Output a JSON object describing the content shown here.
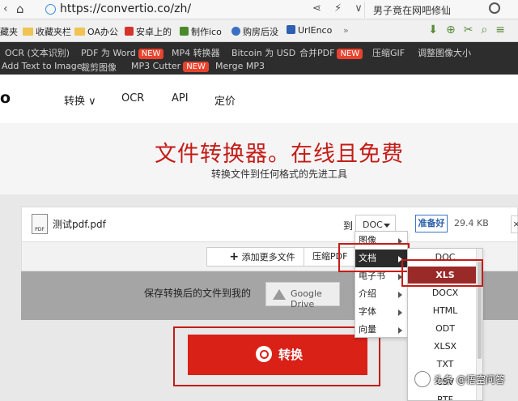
{
  "browser": {
    "url": "https://convertio.co/zh/",
    "search_text": "男子竟在网吧修仙"
  },
  "bookmarks": [
    {
      "label": "藏夹",
      "icon": "folder-icon"
    },
    {
      "label": "收藏夹栏",
      "icon": "folder-icon"
    },
    {
      "label": "OA办公",
      "icon": "folder-icon"
    },
    {
      "label": "安卓上的",
      "icon": "site-icon"
    },
    {
      "label": "制作ico",
      "icon": "site-icon"
    },
    {
      "label": "购房后没",
      "icon": "site-icon"
    },
    {
      "label": "UrlEnco",
      "icon": "site-icon"
    }
  ],
  "tools_row1": [
    {
      "label": "OCR (文本识别)"
    },
    {
      "label": "PDF 为 Word",
      "badge": "NEW"
    },
    {
      "label": "MP4 转换器"
    },
    {
      "label": "Bitcoin 为 USD"
    },
    {
      "label": "合并PDF",
      "badge": "NEW"
    },
    {
      "label": "压缩GIF"
    },
    {
      "label": "调整图像大小"
    }
  ],
  "tools_row2": [
    {
      "label": "Add Text to Image"
    },
    {
      "label": "裁剪图像"
    },
    {
      "label": "MP3 Cutter",
      "badge": "NEW"
    },
    {
      "label": "Merge MP3"
    }
  ],
  "site": {
    "logo_fragment": "o",
    "nav": [
      "转换 ∨",
      "OCR",
      "API",
      "定价"
    ]
  },
  "hero": {
    "title": "文件转换器。在线且免费",
    "subtitle": "转换文件到任何格式的先进工具"
  },
  "file": {
    "icon_label": "PDF",
    "name": "测试pdf.pdf",
    "to_label": "到",
    "format": "DOC",
    "status": "准备好",
    "size": "29.4 KB",
    "remove": "×"
  },
  "actions": {
    "add_more": "添加更多文件",
    "compress": "压缩PDF"
  },
  "save": {
    "label": "保存转换后的文件到我的",
    "gdrive": "Google Drive"
  },
  "convert_label": "转换",
  "category_menu": [
    "图像",
    "文档",
    "电子书",
    "介绍",
    "字体",
    "向量"
  ],
  "category_selected": "文档",
  "format_menu": [
    "DOC",
    "XLS",
    "DOCX",
    "HTML",
    "ODT",
    "XLSX",
    "TXT",
    "CSV",
    "RTF"
  ],
  "format_selected": "XLS",
  "watermark": "头条 @悟空问答"
}
